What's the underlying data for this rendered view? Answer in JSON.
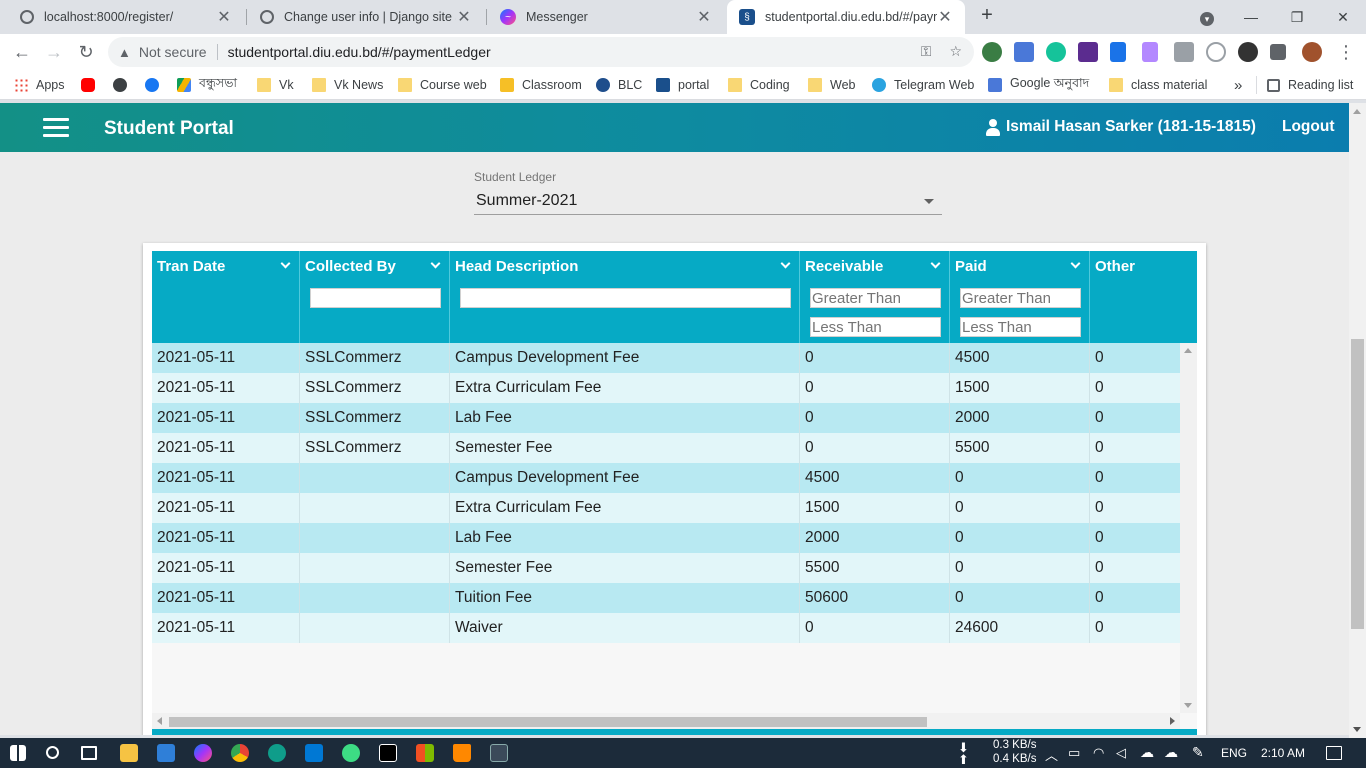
{
  "browser": {
    "tabs": [
      {
        "title": "localhost:8000/register/",
        "icon": "globe-icon"
      },
      {
        "title": "Change user info | Django site ac",
        "icon": "globe-icon"
      },
      {
        "title": "Messenger",
        "icon": "messenger-icon"
      },
      {
        "title": "studentportal.diu.edu.bd/#/paym",
        "icon": "diu-icon",
        "active": true
      }
    ],
    "new_tab": "+",
    "address": {
      "security": "Not secure",
      "url": "studentportal.diu.edu.bd/#/paymentLedger"
    },
    "bookmarks": [
      {
        "label": "Apps",
        "icon": "apps-icon"
      },
      {
        "label": "",
        "icon": "youtube-icon"
      },
      {
        "label": "",
        "icon": "globe-icon"
      },
      {
        "label": "",
        "icon": "facebook-icon"
      },
      {
        "label": "বন্ধুসভা",
        "icon": "drive-icon"
      },
      {
        "label": "Vk",
        "icon": "folder-icon"
      },
      {
        "label": "Vk News",
        "icon": "folder-icon"
      },
      {
        "label": "Course web",
        "icon": "folder-icon"
      },
      {
        "label": "Classroom",
        "icon": "classroom-icon"
      },
      {
        "label": "BLC",
        "icon": "blc-icon"
      },
      {
        "label": "portal",
        "icon": "diu-icon"
      },
      {
        "label": "Coding",
        "icon": "folder-icon"
      },
      {
        "label": "Web",
        "icon": "folder-icon"
      },
      {
        "label": "Telegram Web",
        "icon": "telegram-icon"
      },
      {
        "label": "Google অনুবাদ",
        "icon": "translate-icon"
      },
      {
        "label": "class material",
        "icon": "folder-icon"
      }
    ],
    "more_bookmarks": "»",
    "reading_list": "Reading list"
  },
  "app": {
    "brand": "Student Portal",
    "user": "Ismail Hasan Sarker (181-15-1815)",
    "logout": "Logout"
  },
  "ledger": {
    "label": "Student Ledger",
    "selected": "Summer-2021"
  },
  "grid": {
    "columns": [
      {
        "title": "Tran Date",
        "menu": true
      },
      {
        "title": "Collected By",
        "menu": true,
        "filter": ""
      },
      {
        "title": "Head Description",
        "menu": true,
        "filter": ""
      },
      {
        "title": "Receivable",
        "menu": true,
        "filter_gt": "Greater Than",
        "filter_lt": "Less Than"
      },
      {
        "title": "Paid",
        "menu": true,
        "filter_gt": "Greater Than",
        "filter_lt": "Less Than"
      },
      {
        "title": "Other",
        "menu": false
      }
    ],
    "rows": [
      [
        "2021-05-11",
        "SSLCommerz",
        "Campus Development Fee",
        "0",
        "4500",
        "0"
      ],
      [
        "2021-05-11",
        "SSLCommerz",
        "Extra Curriculam Fee",
        "0",
        "1500",
        "0"
      ],
      [
        "2021-05-11",
        "SSLCommerz",
        "Lab Fee",
        "0",
        "2000",
        "0"
      ],
      [
        "2021-05-11",
        "SSLCommerz",
        "Semester Fee",
        "0",
        "5500",
        "0"
      ],
      [
        "2021-05-11",
        "",
        "Campus Development Fee",
        "4500",
        "0",
        "0"
      ],
      [
        "2021-05-11",
        "",
        "Extra Curriculam Fee",
        "1500",
        "0",
        "0"
      ],
      [
        "2021-05-11",
        "",
        "Lab Fee",
        "2000",
        "0",
        "0"
      ],
      [
        "2021-05-11",
        "",
        "Semester Fee",
        "5500",
        "0",
        "0"
      ],
      [
        "2021-05-11",
        "",
        "Tuition Fee",
        "50600",
        "0",
        "0"
      ],
      [
        "2021-05-11",
        "",
        "Waiver",
        "0",
        "24600",
        "0"
      ]
    ]
  },
  "taskbar": {
    "net_up": "0.3 KB/s",
    "net_down": "0.4 KB/s",
    "lang": "ENG",
    "time": "2:10 AM"
  },
  "colors": {
    "appbar": "#0e8ba0",
    "grid_header": "#06aac5",
    "row_odd": "#b8e9f2",
    "row_even": "#e2f6f9"
  }
}
